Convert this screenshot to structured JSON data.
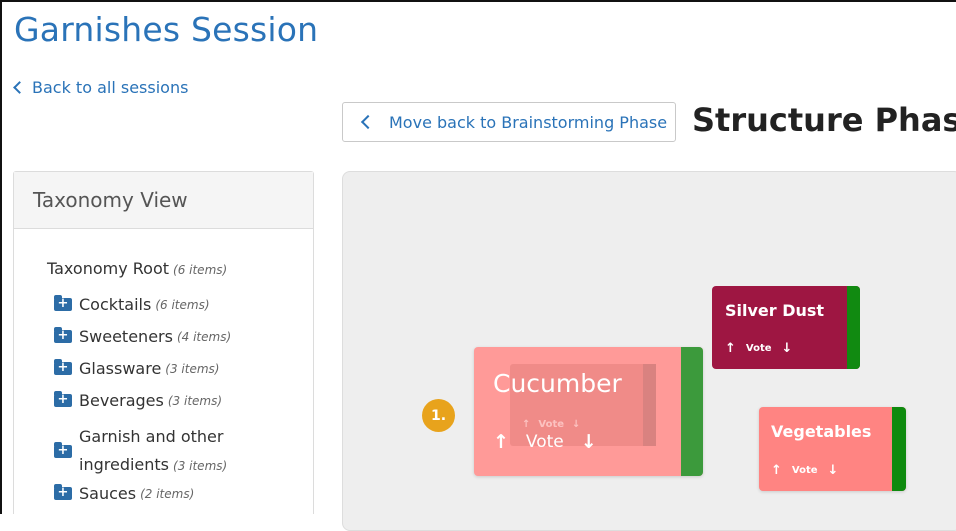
{
  "page": {
    "title": "Garnishes Session",
    "back_link": "Back to all sessions"
  },
  "phase": {
    "back_button": "Move back to Brainstorming Phase",
    "title": "Structure Phase"
  },
  "taxonomy": {
    "header": "Taxonomy View",
    "root": {
      "label": "Taxonomy Root",
      "count": "(6 items)"
    },
    "items": [
      {
        "label": "Cocktails",
        "count": "(6 items)"
      },
      {
        "label": "Sweeteners",
        "count": "(4 items)"
      },
      {
        "label": "Glassware",
        "count": "(3 items)"
      },
      {
        "label": "Beverages",
        "count": "(3 items)"
      },
      {
        "label_line1": "Garnish and other",
        "label_line2": "ingredients",
        "count": "(3 items)"
      },
      {
        "label": "Sauces",
        "count": "(2 items)"
      }
    ]
  },
  "cards": {
    "cucumber": {
      "title": "Cucumber",
      "vote": "Vote",
      "rank": "1.",
      "color": "#ff9a98",
      "stripe": "#3c9a3c"
    },
    "cucumber_ghost": {
      "vote": "Vote"
    },
    "silver_dust": {
      "title": "Silver Dust",
      "vote": "Vote",
      "color": "#9e1642",
      "stripe": "#118a11"
    },
    "vegetables": {
      "title": "Vegetables",
      "vote": "Vote",
      "color": "#ff8482",
      "stripe": "#0e8a0e"
    }
  },
  "icons": {
    "up": "↑",
    "down": "↓"
  }
}
